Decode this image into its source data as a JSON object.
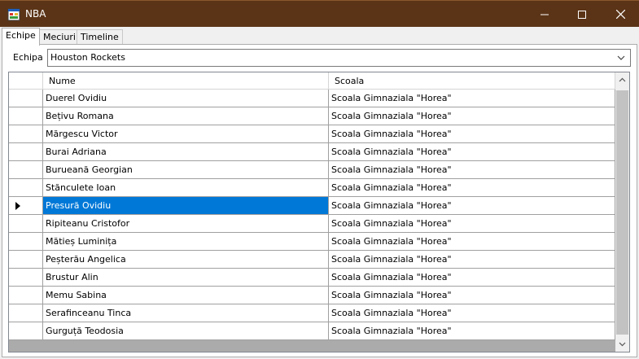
{
  "window": {
    "title": "NBA"
  },
  "tabs": [
    {
      "label": "Echipe",
      "active": true
    },
    {
      "label": "Meciuri",
      "active": false
    },
    {
      "label": "Timeline",
      "active": false
    }
  ],
  "team_picker": {
    "label": "Echipa",
    "value": "Houston Rockets"
  },
  "grid": {
    "columns": [
      "Nume",
      "Scoala"
    ],
    "selected_row": 6,
    "rows": [
      {
        "nume": "Duerel Ovidiu",
        "scoala": "Scoala Gimnaziala \"Horea\""
      },
      {
        "nume": "Bețivu Romana",
        "scoala": "Scoala Gimnaziala \"Horea\""
      },
      {
        "nume": "Mărgescu Victor",
        "scoala": "Scoala Gimnaziala \"Horea\""
      },
      {
        "nume": "Burai Adriana",
        "scoala": "Scoala Gimnaziala \"Horea\""
      },
      {
        "nume": "Burueană Georgian",
        "scoala": "Scoala Gimnaziala \"Horea\""
      },
      {
        "nume": "Stănculete Ioan",
        "scoala": "Scoala Gimnaziala \"Horea\""
      },
      {
        "nume": "Presură Ovidiu",
        "scoala": "Scoala Gimnaziala \"Horea\""
      },
      {
        "nume": "Ripiteanu Cristofor",
        "scoala": "Scoala Gimnaziala \"Horea\""
      },
      {
        "nume": "Mătieș Luminița",
        "scoala": "Scoala Gimnaziala \"Horea\""
      },
      {
        "nume": "Peșterău Angelica",
        "scoala": "Scoala Gimnaziala \"Horea\""
      },
      {
        "nume": "Brustur Alin",
        "scoala": "Scoala Gimnaziala \"Horea\""
      },
      {
        "nume": "Memu Sabina",
        "scoala": "Scoala Gimnaziala \"Horea\""
      },
      {
        "nume": "Serafinceanu Tinca",
        "scoala": "Scoala Gimnaziala \"Horea\""
      },
      {
        "nume": "Gurguță Teodosia",
        "scoala": "Scoala Gimnaziala \"Horea\""
      }
    ]
  },
  "colors": {
    "titlebar": "#5b3417",
    "selection": "#0078d7"
  }
}
